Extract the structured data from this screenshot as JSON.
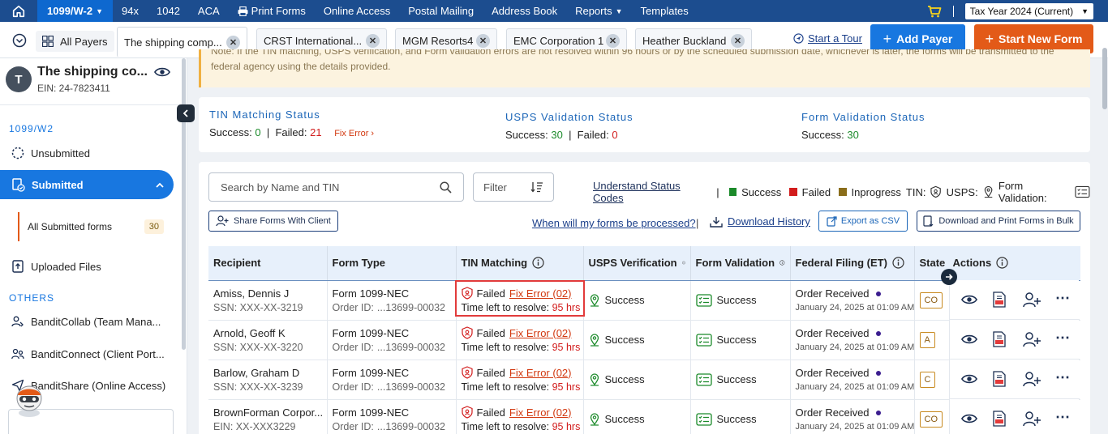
{
  "topnav": {
    "product": "1099/W-2",
    "items": [
      "94x",
      "1042",
      "ACA",
      "Print Forms",
      "Online Access",
      "Postal Mailing",
      "Address Book",
      "Reports",
      "Templates"
    ],
    "tax_year": "Tax Year 2024 (Current)"
  },
  "tabs": {
    "all_payers": "All Payers",
    "payer_tabs": [
      "The shipping comp...",
      "CRST International...",
      "MGM Resorts4",
      "EMC Corporation 1",
      "Heather Buckland"
    ],
    "start_tour": "Start a Tour",
    "add_payer": "Add Payer",
    "start_new_form": "Start New Form"
  },
  "sidebar": {
    "avatar_letter": "T",
    "payer_name": "The shipping co...",
    "ein": "EIN: 24-7823411",
    "section1": "1099/W2",
    "unsubmitted": "Unsubmitted",
    "submitted": "Submitted",
    "all_submitted": "All Submitted forms",
    "all_submitted_count": "30",
    "uploaded": "Uploaded Files",
    "others": "OTHERS",
    "collab": "BanditCollab (Team Mana...",
    "connect": "BanditConnect (Client Port...",
    "share": "BanditShare (Online Access)"
  },
  "notice": {
    "text": "Note: If the TIN matching, USPS verification, and Form validation errors are not resolved within 96 hours or by the scheduled submission date, whichever is later, the forms will be transmitted to the federal agency using the details provided."
  },
  "status": {
    "tin_title": "TIN Matching Status",
    "tin_success_label": "Success:",
    "tin_success": "0",
    "tin_failed_label": "Failed:",
    "tin_failed": "21",
    "fix_error": "Fix Error",
    "usps_title": "USPS Validation Status",
    "usps_success_label": "Success:",
    "usps_success": "30",
    "usps_failed_label": "Failed:",
    "usps_failed": "0",
    "form_title": "Form Validation Status",
    "form_success_label": "Success:",
    "form_success": "30"
  },
  "toolbar": {
    "search_placeholder": "Search by Name and TIN",
    "filter": "Filter",
    "understand": "Understand Status Codes",
    "legend_success": "Success",
    "legend_failed": "Failed",
    "legend_inprogress": "Inprogress",
    "legend_tin": "TIN:",
    "legend_usps": "USPS:",
    "legend_form": "Form Validation:",
    "share": "Share Forms With Client",
    "when": "When will my forms be processed?",
    "download_history": "Download History",
    "export_csv": "Export as CSV",
    "bulk": "Download and Print Forms in Bulk"
  },
  "table": {
    "headers": [
      "Recipient",
      "Form Type",
      "TIN Matching",
      "USPS Verification",
      "Form Validation",
      "Federal Filing (ET)",
      "State F",
      "Actions"
    ],
    "rows": [
      {
        "name": "Amiss, Dennis J",
        "id": "SSN: XXX-XX-3219",
        "form": "Form 1099-NEC",
        "order_label": "Order ID:",
        "order": "...13699-00032",
        "tin_status": "Failed",
        "fix": "Fix Error (02)",
        "time_label": "Time left to resolve:",
        "time": "95 hrs",
        "usps": "Success",
        "formval": "Success",
        "fed": "Order Received",
        "fed_date": "January 24, 2025 at 01:09 AM",
        "state": "CO"
      },
      {
        "name": "Arnold, Geoff K",
        "id": "SSN: XXX-XX-3220",
        "form": "Form 1099-NEC",
        "order_label": "Order ID:",
        "order": "...13699-00032",
        "tin_status": "Failed",
        "fix": "Fix Error (02)",
        "time_label": "Time left to resolve:",
        "time": "95 hrs",
        "usps": "Success",
        "formval": "Success",
        "fed": "Order Received",
        "fed_date": "January 24, 2025 at 01:09 AM",
        "state": "A"
      },
      {
        "name": "Barlow, Graham D",
        "id": "SSN: XXX-XX-3239",
        "form": "Form 1099-NEC",
        "order_label": "Order ID:",
        "order": "...13699-00032",
        "tin_status": "Failed",
        "fix": "Fix Error (02)",
        "time_label": "Time left to resolve:",
        "time": "95 hrs",
        "usps": "Success",
        "formval": "Success",
        "fed": "Order Received",
        "fed_date": "January 24, 2025 at 01:09 AM",
        "state": "C"
      },
      {
        "name": "BrownForman Corpor...",
        "id": "EIN: XX-XXX3229",
        "form": "Form 1099-NEC",
        "order_label": "Order ID:",
        "order": "...13699-00032",
        "tin_status": "Failed",
        "fix": "Fix Error (02)",
        "time_label": "Time left to resolve:",
        "time": "95 hrs",
        "usps": "Success",
        "formval": "Success",
        "fed": "Order Received",
        "fed_date": "January 24, 2025 at 01:09 AM",
        "state": "CO"
      }
    ]
  },
  "colors": {
    "nav": "#1c4d8f",
    "primary": "#1877e0",
    "accent": "#e35a18",
    "success": "#1b8a2a",
    "failed": "#d21c1c",
    "inprogress": "#8a6d1a"
  }
}
